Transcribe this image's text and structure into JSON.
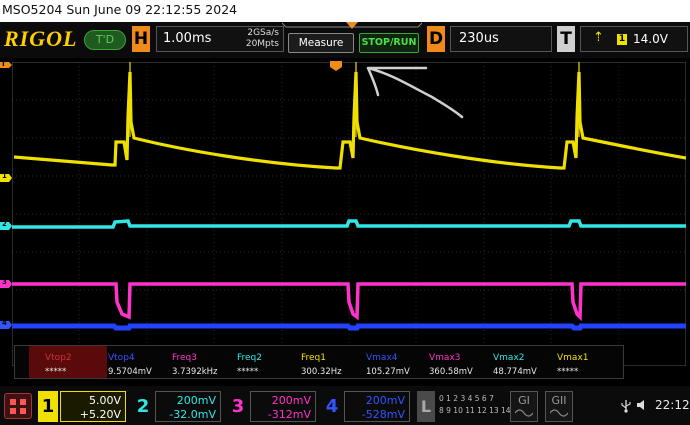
{
  "title_line": "MSO5204  Sun June 09 22:12:55 2024",
  "header": {
    "logo": "RIGOL",
    "trig_status": "T'D",
    "horizontal": {
      "key": "H",
      "timebase": "1.00ms",
      "sample_rate": "2GSa/s",
      "memory_depth": "20Mpts"
    },
    "measure_button": "Measure",
    "stop_run_button": "STOP/RUN",
    "delay": {
      "key": "D",
      "value": "230us"
    },
    "trigger": {
      "key": "T",
      "slope_icon": "rising-edge",
      "source": "1",
      "level": "14.0V"
    }
  },
  "markers": {
    "trigger_pos": "T",
    "ch1": "1",
    "ch2": "2",
    "ch3": "3",
    "ch4": "4"
  },
  "measurements": [
    {
      "name": "Vtop2",
      "value": "*****",
      "color": "#cc3333",
      "highlighted": true
    },
    {
      "name": "Vtop4",
      "value": "9.5704mV",
      "color": "#3355ff",
      "highlighted": false
    },
    {
      "name": "Freq3",
      "value": "3.7392kHz",
      "color": "#ff33cc",
      "highlighted": false
    },
    {
      "name": "Freq2",
      "value": "*****",
      "color": "#33e6e6",
      "highlighted": false
    },
    {
      "name": "Freq1",
      "value": "300.32Hz",
      "color": "#f0e000",
      "highlighted": false
    },
    {
      "name": "Vmax4",
      "value": "105.27mV",
      "color": "#3355ff",
      "highlighted": false
    },
    {
      "name": "Vmax3",
      "value": "360.58mV",
      "color": "#ff33cc",
      "highlighted": false
    },
    {
      "name": "Vmax2",
      "value": "48.774mV",
      "color": "#33e6e6",
      "highlighted": false
    },
    {
      "name": "Vmax1",
      "value": "*****",
      "color": "#f0e000",
      "highlighted": false
    }
  ],
  "channels": [
    {
      "num": "1",
      "scale": "5.00V",
      "offset": "+5.20V",
      "color": "#f0e000",
      "active": true
    },
    {
      "num": "2",
      "scale": "200mV",
      "offset": "-32.0mV",
      "color": "#33e6e6",
      "active": false
    },
    {
      "num": "3",
      "scale": "200mV",
      "offset": "-312mV",
      "color": "#ff33cc",
      "active": false
    },
    {
      "num": "4",
      "scale": "200mV",
      "offset": "-528mV",
      "color": "#3355ff",
      "active": false
    }
  ],
  "logic": {
    "key": "L",
    "digits_row1": "0 1 2 3 4 5 6 7",
    "digits_row2": "8 9 10 11 12 13 14 15"
  },
  "gen_buttons": [
    {
      "label": "GI"
    },
    {
      "label": "GII"
    }
  ],
  "status": {
    "usb_icon": "usb-icon",
    "sound_icon": "speaker-icon",
    "time": "22:12"
  },
  "colors": {
    "ch1": "#f0e000",
    "ch2": "#33e6e6",
    "ch3": "#ff33cc",
    "ch4": "#3355ff",
    "accent": "#f08a1a"
  }
}
